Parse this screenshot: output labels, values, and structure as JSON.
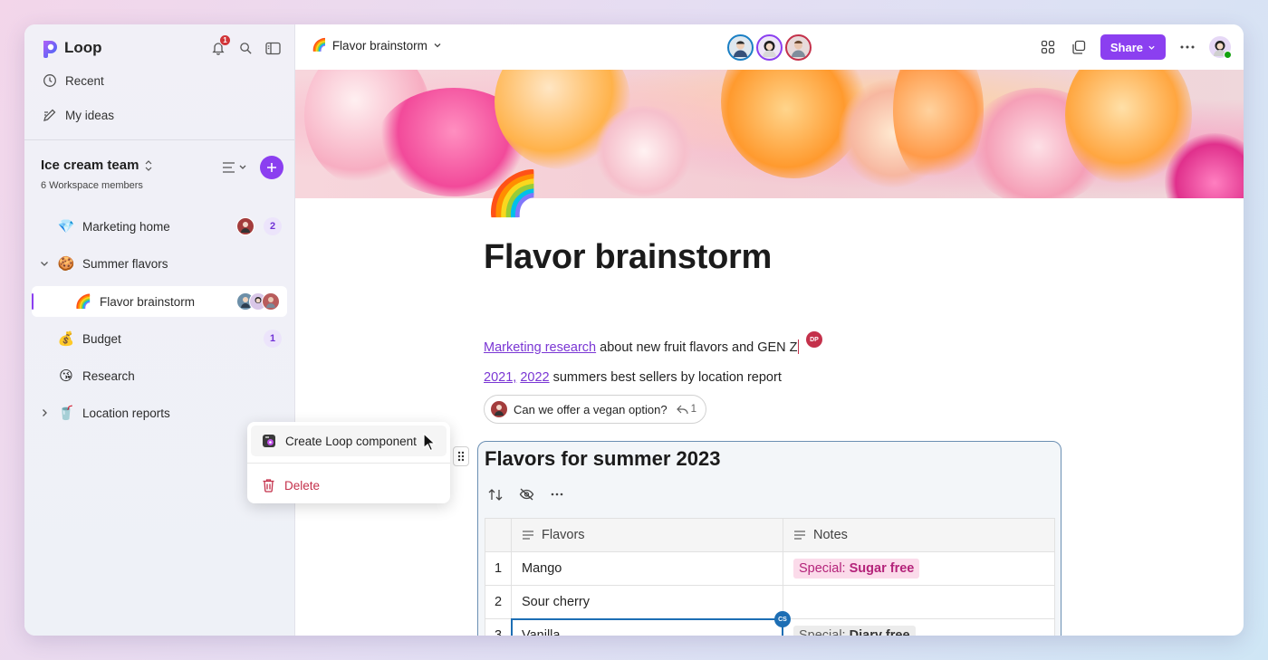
{
  "app": {
    "name": "Loop",
    "notification_count": "1"
  },
  "sidebar": {
    "links": [
      {
        "label": "Recent",
        "icon": "clock-icon"
      },
      {
        "label": "My ideas",
        "icon": "ideas-icon"
      }
    ],
    "workspace": {
      "name": "Ice cream team",
      "members": "6 Workspace members"
    },
    "items": [
      {
        "label": "Marketing home",
        "emoji": "💎",
        "badge": "2"
      },
      {
        "label": "Summer flavors",
        "emoji": "🍪"
      },
      {
        "label": "Flavor brainstorm",
        "emoji": "🌈"
      },
      {
        "label": "Budget",
        "emoji": "💰",
        "badge": "1"
      },
      {
        "label": "Research",
        "emoji": "😘"
      },
      {
        "label": "Location reports",
        "emoji": "🥤"
      }
    ]
  },
  "topbar": {
    "page_emoji": "🌈",
    "page_name": "Flavor brainstorm",
    "share_label": "Share"
  },
  "doc": {
    "page_emoji": "🌈",
    "title": "Flavor brainstorm",
    "line1": {
      "link": "Marketing research",
      "text": " about new fruit flavors and GEN Z",
      "cursor_tag": "DP"
    },
    "line2": {
      "link1": "2021,",
      "link2": "2022",
      "text": " summers best sellers by location report"
    },
    "comment": {
      "text": "Can we offer a vegan option?",
      "replies": "1"
    }
  },
  "card": {
    "title": "Flavors for summer 2023",
    "columns": [
      "Flavors",
      "Notes"
    ],
    "rows": [
      {
        "num": "1",
        "flavor": "Mango",
        "note_prefix": "Special:",
        "note_value": "Sugar free",
        "note_style": "pink"
      },
      {
        "num": "2",
        "flavor": "Sour cherry",
        "note_prefix": "",
        "note_value": ""
      },
      {
        "num": "3",
        "flavor": "Vanilla",
        "note_prefix": "Special:",
        "note_value": "Diary free",
        "note_style": "gray"
      }
    ],
    "cursor_tag": "CS"
  },
  "context_menu": {
    "create_label": "Create Loop component",
    "delete_label": "Delete"
  },
  "colors": {
    "accent": "#8b3ff0",
    "selection": "#1d6eb4",
    "delete": "#c4314b"
  }
}
